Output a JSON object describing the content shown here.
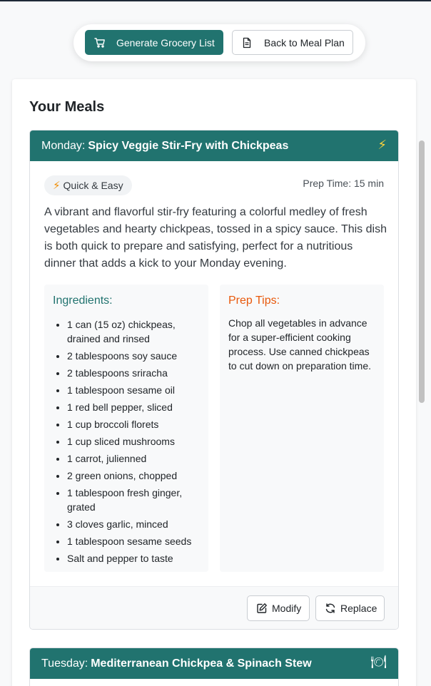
{
  "toolbar": {
    "generate_label": "Generate Grocery List",
    "back_label": "Back to Meal Plan"
  },
  "section_title": "Your Meals",
  "meals": [
    {
      "day": "Monday:",
      "name": "Spicy Veggie Stir-Fry with Chickpeas",
      "header_icon": "⚡",
      "badge": "Quick & Easy",
      "badge_icon": "⚡",
      "prep_time": "Prep Time: 15 min",
      "description": "A vibrant and flavorful stir-fry featuring a colorful medley of fresh vegetables and hearty chickpeas, tossed in a spicy sauce. This dish is both quick to prepare and satisfying, perfect for a nutritious dinner that adds a kick to your Monday evening.",
      "ingredients_title": "Ingredients:",
      "ingredients": [
        "1 can (15 oz) chickpeas, drained and rinsed",
        "2 tablespoons soy sauce",
        "2 tablespoons sriracha",
        "1 tablespoon sesame oil",
        "1 red bell pepper, sliced",
        "1 cup broccoli florets",
        "1 cup sliced mushrooms",
        "1 carrot, julienned",
        "2 green onions, chopped",
        "1 tablespoon fresh ginger, grated",
        "3 cloves garlic, minced",
        "1 tablespoon sesame seeds",
        "Salt and pepper to taste"
      ],
      "tips_title": "Prep Tips:",
      "tips": "Chop all vegetables in advance for a super-efficient cooking process. Use canned chickpeas to cut down on preparation time.",
      "modify_label": "Modify",
      "replace_label": "Replace"
    },
    {
      "day": "Tuesday:",
      "name": "Mediterranean Chickpea & Spinach Stew",
      "header_icon": "🍽"
    }
  ],
  "colors": {
    "primary": "#21736f",
    "tips_accent": "#e8590c",
    "bolt": "#f08c00"
  }
}
